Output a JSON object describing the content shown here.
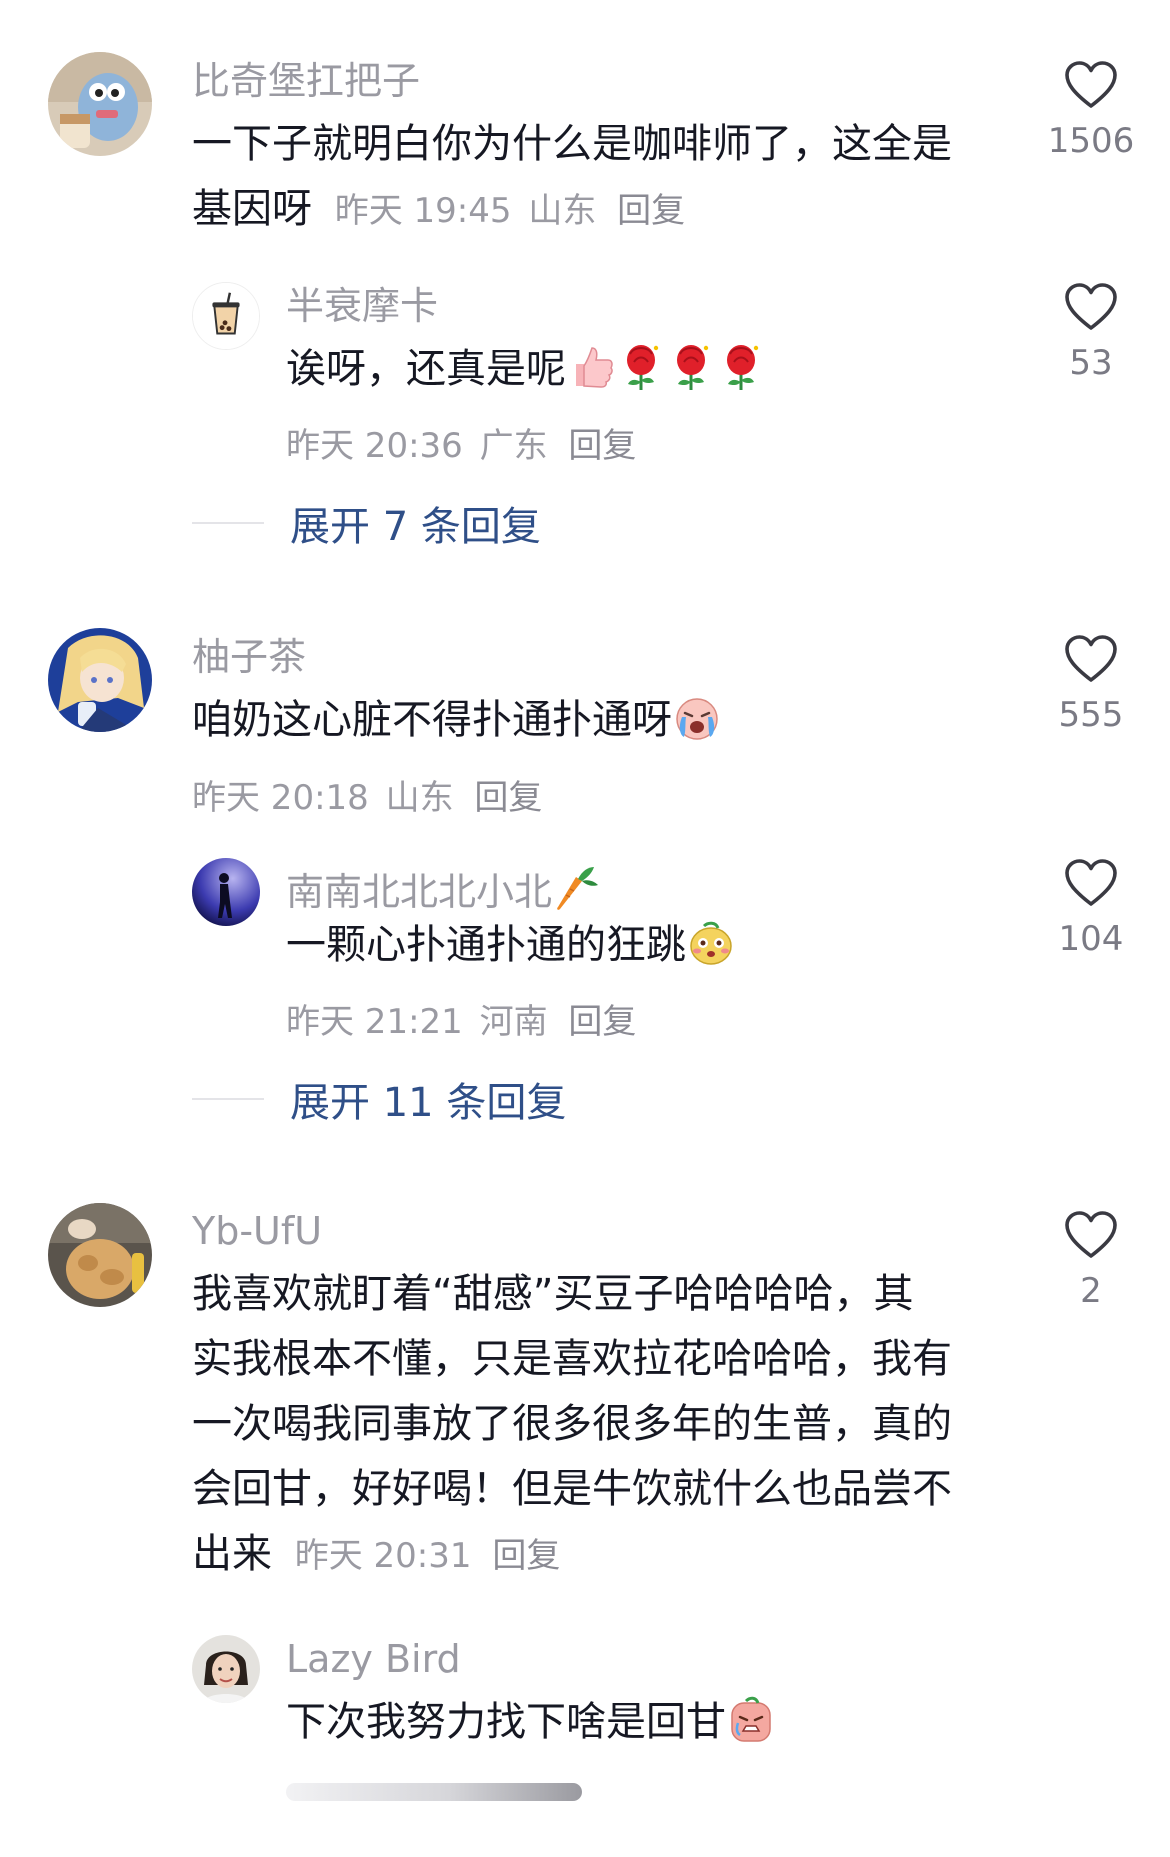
{
  "comments": [
    {
      "username": "比奇堡扛把子",
      "text_line1": "一下子就明白你为什么是咖啡师了，这全是",
      "text_line2": "基因呀",
      "time": "昨天 19:45",
      "location": "山东",
      "reply": "回复",
      "likes": "1506",
      "avatar": "avatar-plush-toy-with-coffee",
      "replies": [
        {
          "username": "半衰摩卡",
          "text": "诶呀，还真是呢",
          "emojis": [
            "thumbs-up-emoji",
            "rose-emoji",
            "rose-emoji",
            "rose-emoji"
          ],
          "time": "昨天 20:36",
          "location": "广东",
          "reply": "回复",
          "likes": "53",
          "avatar": "avatar-bubble-tea"
        }
      ],
      "expand_label": "展开 7 条回复"
    },
    {
      "username": "柚子茶",
      "text": "咱奶这心脏不得扑通扑通呀",
      "emojis": [
        "crying-face-emoji"
      ],
      "time": "昨天 20:18",
      "location": "山东",
      "reply": "回复",
      "likes": "555",
      "avatar": "avatar-anime-girl",
      "replies": [
        {
          "username": "南南北北北小北",
          "username_emoji": "carrot-emoji",
          "text": "一颗心扑通扑通的狂跳",
          "emojis": [
            "blushing-face-emoji"
          ],
          "time": "昨天 21:21",
          "location": "河南",
          "reply": "回复",
          "likes": "104",
          "avatar": "avatar-person-silhouette-blue"
        }
      ],
      "expand_label": "展开 11 条回复"
    },
    {
      "username": "Yb-UfU",
      "text_lines": [
        "我喜欢就盯着“甜感”买豆子哈哈哈哈，其",
        "实我根本不懂，只是喜欢拉花哈哈哈，我有",
        "一次喝我同事放了很多很多年的生普，真的",
        "会回甘，好好喝！但是牛饮就什么也品尝不",
        "出来"
      ],
      "time": "昨天 20:31",
      "reply": "回复",
      "likes": "2",
      "avatar": "avatar-cat-photo",
      "replies": [
        {
          "username": "Lazy Bird",
          "text": "下次我努力找下啥是回甘",
          "emojis": [
            "sad-face-emoji"
          ],
          "avatar": "avatar-woman-photo"
        }
      ]
    }
  ],
  "colors": {
    "username": "#9a9aa2",
    "text": "#161823",
    "expand_link": "#2f4f88",
    "heart_outline": "#3a3a42"
  }
}
